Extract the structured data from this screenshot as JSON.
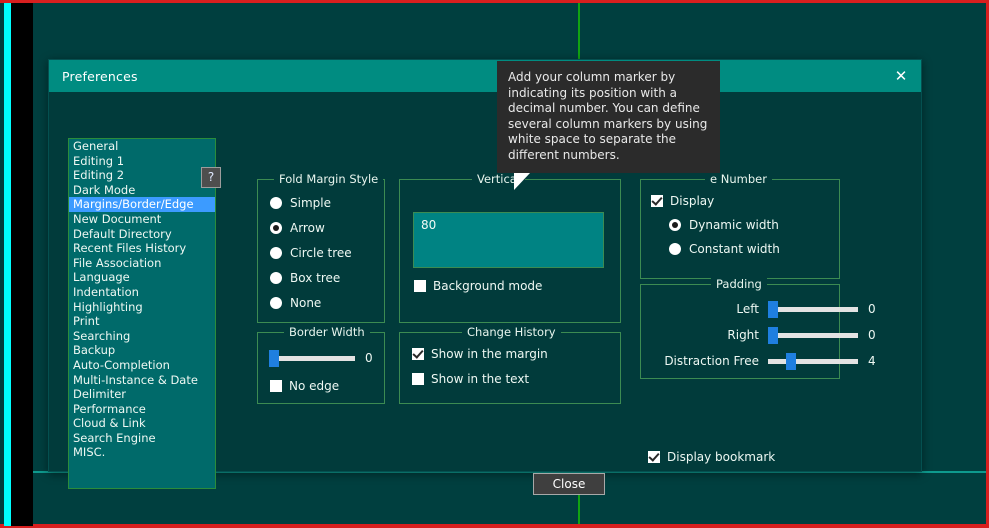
{
  "window": {
    "title": "Preferences",
    "close_icon": "close-x-icon"
  },
  "sidebar": {
    "items": [
      {
        "label": "General",
        "selected": false
      },
      {
        "label": "Editing 1",
        "selected": false
      },
      {
        "label": "Editing 2",
        "selected": false
      },
      {
        "label": "Dark Mode",
        "selected": false
      },
      {
        "label": "Margins/Border/Edge",
        "selected": true
      },
      {
        "label": "New Document",
        "selected": false
      },
      {
        "label": "Default Directory",
        "selected": false
      },
      {
        "label": "Recent Files History",
        "selected": false
      },
      {
        "label": "File Association",
        "selected": false
      },
      {
        "label": "Language",
        "selected": false
      },
      {
        "label": "Indentation",
        "selected": false
      },
      {
        "label": "Highlighting",
        "selected": false
      },
      {
        "label": "Print",
        "selected": false
      },
      {
        "label": "Searching",
        "selected": false
      },
      {
        "label": "Backup",
        "selected": false
      },
      {
        "label": "Auto-Completion",
        "selected": false
      },
      {
        "label": "Multi-Instance & Date",
        "selected": false
      },
      {
        "label": "Delimiter",
        "selected": false
      },
      {
        "label": "Performance",
        "selected": false
      },
      {
        "label": "Cloud & Link",
        "selected": false
      },
      {
        "label": "Search Engine",
        "selected": false
      },
      {
        "label": "MISC.",
        "selected": false
      }
    ]
  },
  "fold_margin_style": {
    "legend": "Fold Margin Style",
    "options": [
      {
        "label": "Simple",
        "selected": false
      },
      {
        "label": "Arrow",
        "selected": true
      },
      {
        "label": "Circle tree",
        "selected": false
      },
      {
        "label": "Box tree",
        "selected": false
      },
      {
        "label": "None",
        "selected": false
      }
    ]
  },
  "border_width": {
    "legend": "Border Width",
    "value": "0",
    "slider_percent": 0,
    "no_edge": {
      "label": "No edge",
      "checked": false
    }
  },
  "vertical_edge": {
    "legend": "Vertical",
    "help_label": "?",
    "value": "80",
    "background_mode": {
      "label": "Background mode",
      "checked": false
    }
  },
  "change_history": {
    "legend": "Change History",
    "options": [
      {
        "label": "Show in the margin",
        "checked": true
      },
      {
        "label": "Show in the text",
        "checked": false
      }
    ]
  },
  "line_number": {
    "legend": "e Number",
    "display": {
      "label": "Display",
      "checked": true
    },
    "width_options": [
      {
        "label": "Dynamic width",
        "selected": true
      },
      {
        "label": "Constant width",
        "selected": false
      }
    ]
  },
  "padding": {
    "legend": "Padding",
    "sliders": [
      {
        "label": "Left",
        "value": "0",
        "percent": 0
      },
      {
        "label": "Right",
        "value": "0",
        "percent": 0
      },
      {
        "label": "Distraction Free",
        "value": "4",
        "percent": 22
      }
    ]
  },
  "display_bookmark": {
    "label": "Display bookmark",
    "checked": true
  },
  "buttons": {
    "close": "Close"
  },
  "tooltip": {
    "text": "Add your column marker by indicating its position with a decimal number. You can define several column markers by using white space to separate the different numbers."
  },
  "colors": {
    "accent_teal": "#008c81",
    "dialog_bg": "#013b3b",
    "selection_blue": "#3c9bff",
    "group_border_green": "#3c8b52",
    "marker_green": "#12a312",
    "red_border": "#d81f1f"
  }
}
